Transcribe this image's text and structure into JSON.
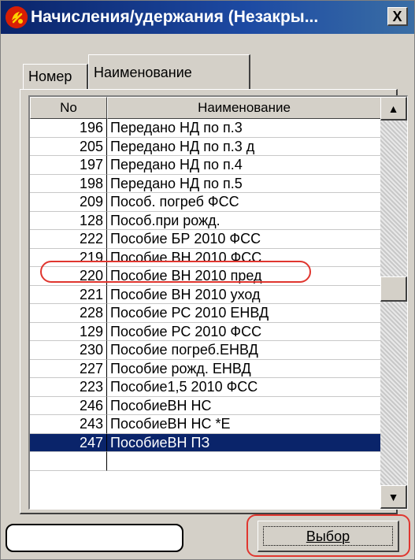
{
  "window": {
    "title": "Начисления/удержания (Незакры...",
    "close_label": "X",
    "app_icon_color": "#d81e05"
  },
  "tabs": [
    {
      "label": "Номер",
      "active": false
    },
    {
      "label": "Наименование",
      "active": true
    }
  ],
  "grid": {
    "columns": [
      "No",
      "Наименование"
    ],
    "rows": [
      {
        "no": "196",
        "name": "Передано НД по п.3"
      },
      {
        "no": "205",
        "name": "Передано НД по п.3 д"
      },
      {
        "no": "197",
        "name": "Передано НД по п.4"
      },
      {
        "no": "198",
        "name": "Передано НД по п.5"
      },
      {
        "no": "209",
        "name": "Пособ. погреб ФСС"
      },
      {
        "no": "128",
        "name": "Пособ.при рожд."
      },
      {
        "no": "222",
        "name": "Пособие БР 2010 ФСС"
      },
      {
        "no": "219",
        "name": "Пособие ВН 2010 ФСС"
      },
      {
        "no": "220",
        "name": "Пособие ВН 2010 пред"
      },
      {
        "no": "221",
        "name": "Пособие ВН 2010 уход"
      },
      {
        "no": "228",
        "name": "Пособие РС 2010 ЕНВД"
      },
      {
        "no": "129",
        "name": "Пособие РС 2010 ФСС"
      },
      {
        "no": "230",
        "name": "Пособие погреб.ЕНВД"
      },
      {
        "no": "227",
        "name": "Пособие рожд. ЕНВД"
      },
      {
        "no": "223",
        "name": "Пособие1,5 2010 ФСС"
      },
      {
        "no": "246",
        "name": "ПособиеВН НС"
      },
      {
        "no": "243",
        "name": "ПособиеВН НС *Е"
      },
      {
        "no": "247",
        "name": "ПособиеВН ПЗ"
      }
    ],
    "selected_no": "247",
    "highlighted_no": "219",
    "selection_color": "#0a246a",
    "highlight_color": "#e0362f"
  },
  "buttons": {
    "select_label": "Выбор",
    "scroll_up": "▲",
    "scroll_down": "▼"
  },
  "status_field": {
    "value": ""
  }
}
